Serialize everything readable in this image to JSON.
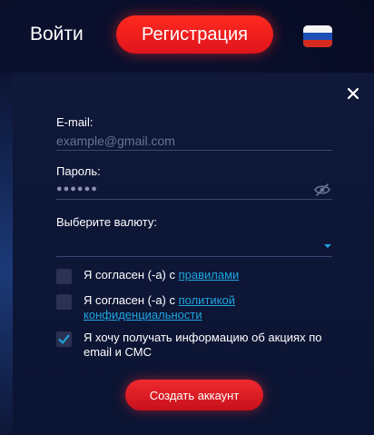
{
  "header": {
    "login_label": "Войти",
    "register_label": "Регистрация",
    "language_flag": "flag-ru-icon"
  },
  "form": {
    "email_label": "E-mail:",
    "email_placeholder": "example@gmail.com",
    "password_label": "Пароль:",
    "password_value": "●●●●●●",
    "currency_label": "Выберите валюту:",
    "currency_value": "",
    "checkboxes": [
      {
        "prefix": "Я согласен (-а) с ",
        "link": "правилами",
        "checked": false
      },
      {
        "prefix": "Я согласен (-а) с ",
        "link": "политикой конфиденциальности",
        "checked": false
      },
      {
        "prefix": "Я хочу получать информацию об акциях по email и СМС",
        "link": "",
        "checked": true
      }
    ],
    "submit_label": "Создать аккаунт"
  },
  "colors": {
    "accent_red": "#e8141d",
    "link_blue": "#1ea7e0",
    "background": "#0b1130"
  }
}
